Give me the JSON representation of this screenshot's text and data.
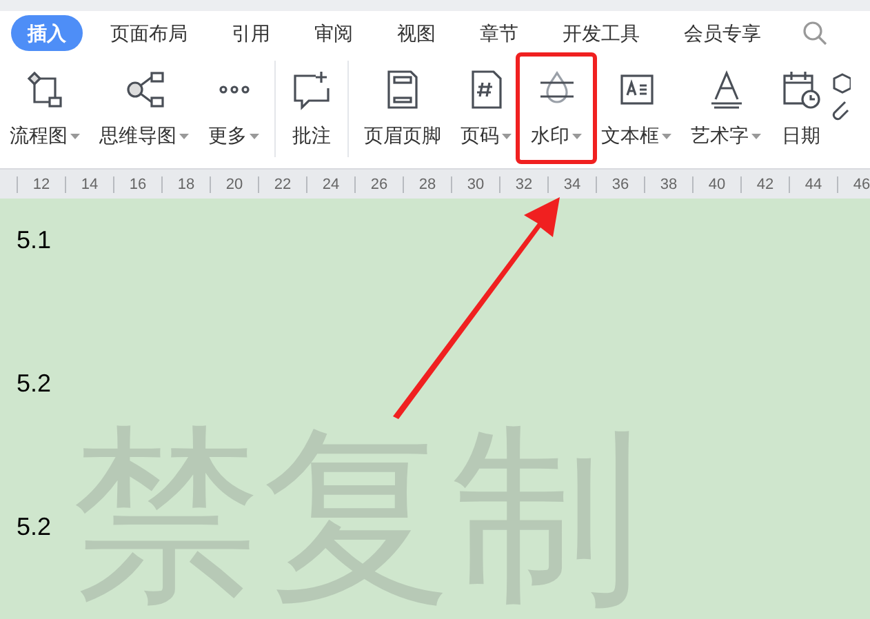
{
  "tabs": [
    {
      "label": "插入",
      "selected": true
    },
    {
      "label": "页面布局",
      "selected": false
    },
    {
      "label": "引用",
      "selected": false
    },
    {
      "label": "审阅",
      "selected": false
    },
    {
      "label": "视图",
      "selected": false
    },
    {
      "label": "章节",
      "selected": false
    },
    {
      "label": "开发工具",
      "selected": false
    },
    {
      "label": "会员专享",
      "selected": false
    }
  ],
  "ribbon": [
    {
      "kind": "flowchart",
      "label": "流程图",
      "dropdown": true,
      "highlighted": false
    },
    {
      "kind": "mindmap",
      "label": "思维导图",
      "dropdown": true,
      "highlighted": false
    },
    {
      "kind": "more",
      "label": "更多",
      "dropdown": true,
      "highlighted": false
    },
    {
      "kind": "divider"
    },
    {
      "kind": "comment",
      "label": "批注",
      "dropdown": false,
      "highlighted": false
    },
    {
      "kind": "divider"
    },
    {
      "kind": "header",
      "label": "页眉页脚",
      "dropdown": false,
      "highlighted": false
    },
    {
      "kind": "pagenum",
      "label": "页码",
      "dropdown": true,
      "highlighted": false
    },
    {
      "kind": "watermark",
      "label": "水印",
      "dropdown": true,
      "highlighted": true
    },
    {
      "kind": "textbox",
      "label": "文本框",
      "dropdown": true,
      "highlighted": false
    },
    {
      "kind": "wordart",
      "label": "艺术字",
      "dropdown": true,
      "highlighted": false
    },
    {
      "kind": "date",
      "label": "日期",
      "dropdown": false,
      "highlighted": false
    }
  ],
  "ruler": [
    "12",
    "14",
    "16",
    "18",
    "20",
    "22",
    "24",
    "26",
    "28",
    "30",
    "32",
    "34",
    "36",
    "38",
    "40",
    "42",
    "44",
    "46"
  ],
  "document": {
    "lines": [
      "5.1",
      "5.2",
      "5.2"
    ],
    "watermark": "禁复制"
  }
}
